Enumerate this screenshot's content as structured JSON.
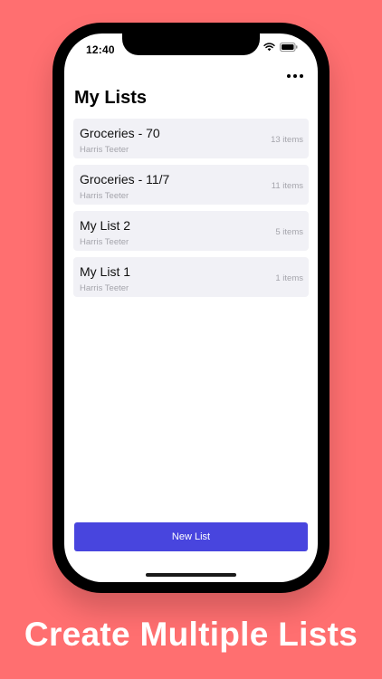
{
  "status_bar": {
    "time": "12:40"
  },
  "header": {
    "title": "My Lists"
  },
  "lists": [
    {
      "name": "Groceries - 70",
      "store": "Harris Teeter",
      "count": "13 items"
    },
    {
      "name": "Groceries - 11/7",
      "store": "Harris Teeter",
      "count": "11 items"
    },
    {
      "name": "My List 2",
      "store": "Harris Teeter",
      "count": "5 items"
    },
    {
      "name": "My List 1",
      "store": "Harris Teeter",
      "count": "1 items"
    }
  ],
  "new_list_button": {
    "label": "New List"
  },
  "caption": {
    "text": "Create Multiple Lists"
  },
  "colors": {
    "background": "#FF6F70",
    "button": "#4845DE",
    "row_background": "#F1F1F6"
  },
  "icons": {
    "more": "more-horizontal-icon",
    "wifi": "wifi-icon",
    "battery": "battery-icon"
  }
}
